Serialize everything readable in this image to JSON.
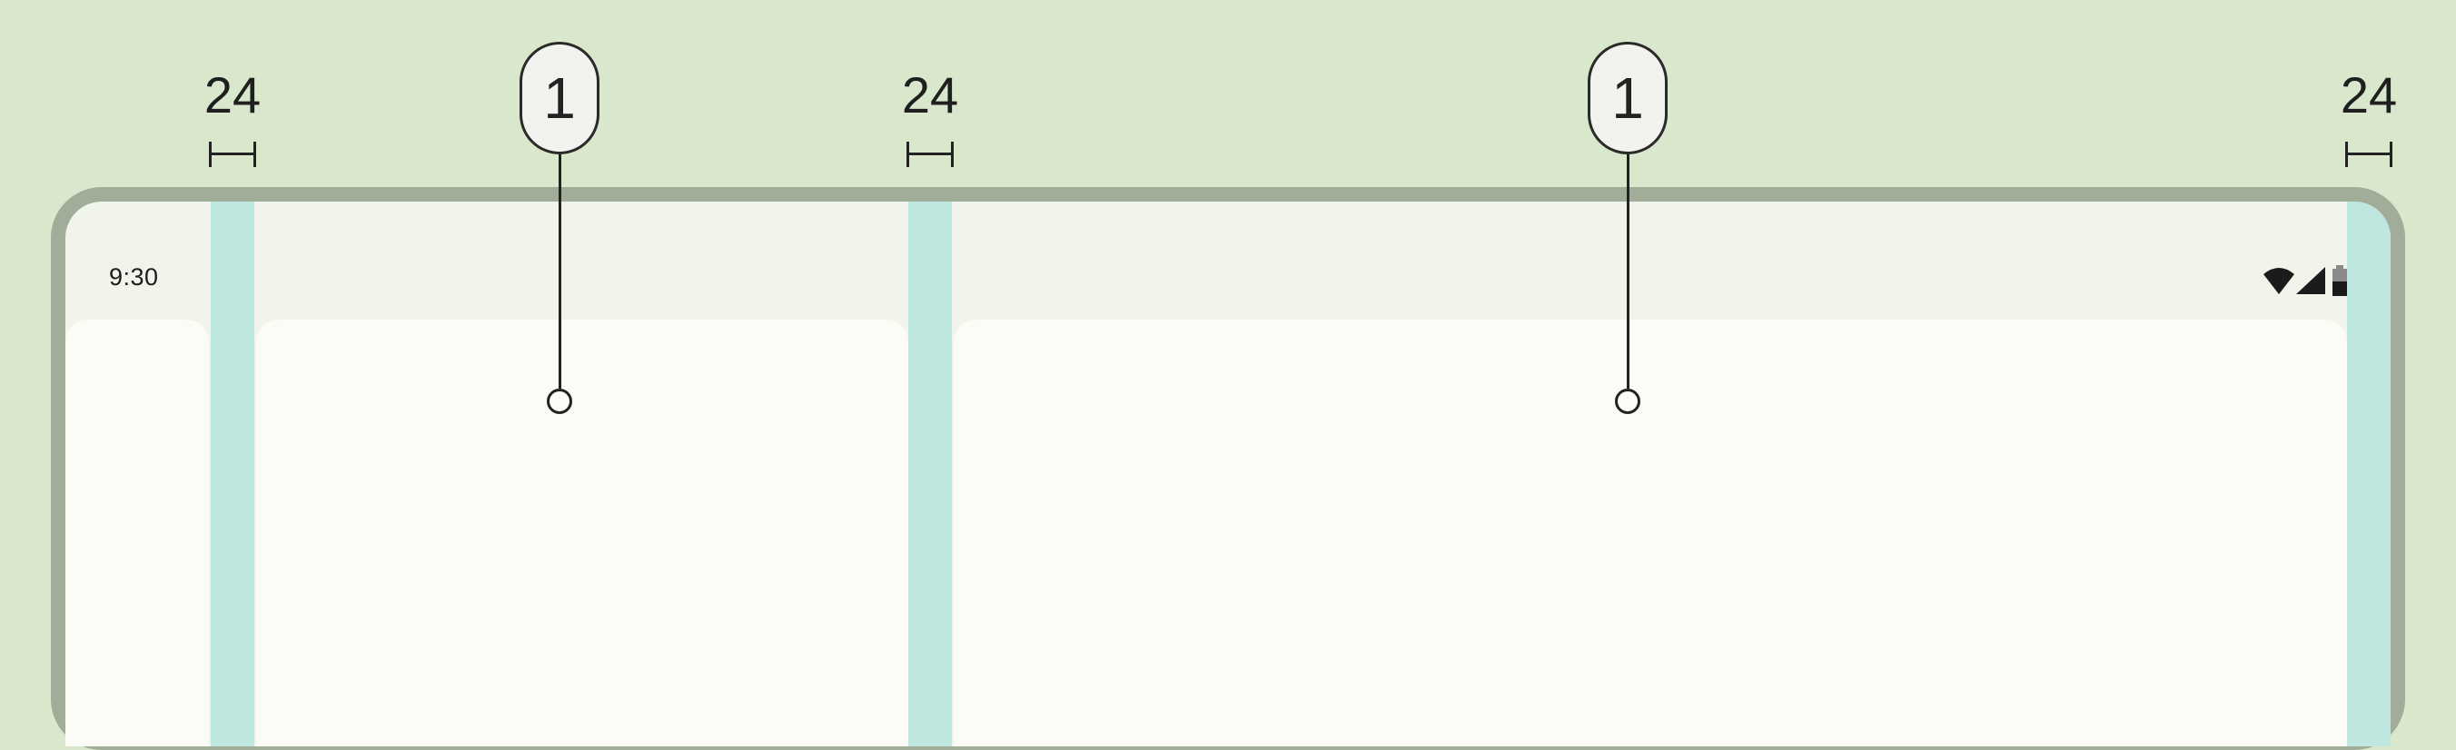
{
  "measurements": {
    "margin_left": "24",
    "gutter_middle": "24",
    "margin_right": "24"
  },
  "callouts": {
    "pane_left": "1",
    "pane_right": "1"
  },
  "status_bar": {
    "time": "9:30",
    "icons": [
      "wifi-icon",
      "cellular-signal-icon",
      "battery-icon"
    ]
  },
  "colors": {
    "background": "#d9e7cc",
    "device_frame": "#a2ad99",
    "screen": "#f0f4ea",
    "pane": "#fcfcf6",
    "gutter_highlight": "#bfe7e0"
  }
}
